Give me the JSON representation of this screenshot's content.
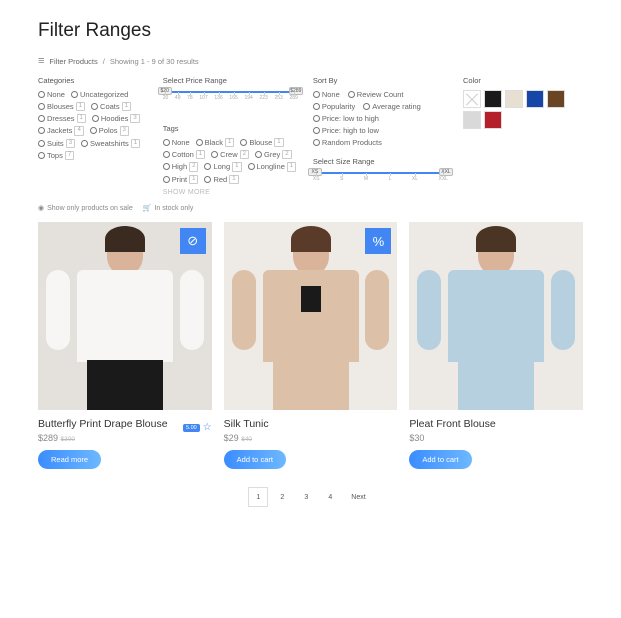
{
  "title": "Filter Ranges",
  "crumb": {
    "link": "Filter Products",
    "sep": "/",
    "info": "Showing 1 - 9 of 30 results"
  },
  "sections": {
    "categories": "Categories",
    "price": "Select Price Range",
    "tags": "Tags",
    "sort": "Sort By",
    "size": "Select Size Range",
    "color": "Color",
    "showmore": "SHOW MORE"
  },
  "categories": [
    {
      "l": "None",
      "c": null
    },
    {
      "l": "Uncategorized",
      "c": null
    },
    {
      "l": "Blouses",
      "c": "1"
    },
    {
      "l": "Coats",
      "c": "1"
    },
    {
      "l": "Dresses",
      "c": "1"
    },
    {
      "l": "Hoodies",
      "c": "3"
    },
    {
      "l": "Jackets",
      "c": "4"
    },
    {
      "l": "Polos",
      "c": "3"
    },
    {
      "l": "Suits",
      "c": "3"
    },
    {
      "l": "Sweatshirts",
      "c": "1"
    },
    {
      "l": "Tops",
      "c": "7"
    }
  ],
  "priceRange": {
    "min": "$20",
    "max": "$289",
    "ticks": [
      "20",
      "49",
      "78",
      "107",
      "136",
      "165",
      "194",
      "223",
      "253",
      "289"
    ]
  },
  "tags": [
    {
      "l": "None",
      "c": null
    },
    {
      "l": "Black",
      "c": "1"
    },
    {
      "l": "Blouse",
      "c": "1"
    },
    {
      "l": "Cotton",
      "c": "1"
    },
    {
      "l": "Crew",
      "c": "2"
    },
    {
      "l": "Grey",
      "c": "2"
    },
    {
      "l": "High",
      "c": "2"
    },
    {
      "l": "Long",
      "c": "1"
    },
    {
      "l": "Longline",
      "c": "1"
    },
    {
      "l": "Print",
      "c": "1"
    },
    {
      "l": "Red",
      "c": "1"
    }
  ],
  "sort": [
    "None",
    "Review Count",
    "Popularity",
    "Average rating",
    "Price: low to high",
    "Price: high to low",
    "Random Products"
  ],
  "sizeRange": {
    "min": "XS",
    "max": "XXL",
    "ticks": [
      "XS",
      "S",
      "M",
      "L",
      "XL",
      "XXL"
    ]
  },
  "colors": [
    "none",
    "#1a1a1a",
    "#e8dfd3",
    "#1646a8",
    "#6b4423",
    "#d9d9d9",
    "#b5202a"
  ],
  "extra": {
    "sale": "Show only products on sale",
    "stock": "In stock only"
  },
  "products": [
    {
      "name": "Butterfly Print Drape Blouse",
      "price": "$289",
      "oldprice": "$300",
      "btn": "Read more",
      "badge": "empty",
      "rating": "5.00"
    },
    {
      "name": "Silk Tunic",
      "price": "$29",
      "oldprice": "$40",
      "btn": "Add to cart",
      "badge": "percent"
    },
    {
      "name": "Pleat Front Blouse",
      "price": "$30",
      "btn": "Add to cart"
    }
  ],
  "pager": {
    "pages": [
      "1",
      "2",
      "3",
      "4"
    ],
    "next": "Next",
    "current": 0
  }
}
